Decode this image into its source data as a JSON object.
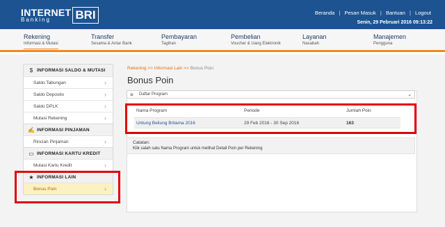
{
  "header": {
    "logo_main": "INTERNET",
    "logo_sub": "Banking",
    "logo_bri": "BRI",
    "links": [
      "Beranda",
      "Pesan Masuk",
      "Bantuan",
      "Logout"
    ],
    "separator": "|",
    "datetime": "Senin, 29 Pebruari 2016 09:13:22"
  },
  "nav": [
    {
      "title": "Rekening",
      "subtitle": "Informasi & Mutasi"
    },
    {
      "title": "Transfer",
      "subtitle": "Sesama & Antar Bank"
    },
    {
      "title": "Pembayaran",
      "subtitle": "Tagihan"
    },
    {
      "title": "Pembelian",
      "subtitle": "Voucher & Uang Elektronik"
    },
    {
      "title": "Layanan",
      "subtitle": "Nasabah"
    },
    {
      "title": "Manajemen",
      "subtitle": "Pengguna"
    }
  ],
  "sidebar": {
    "sections": [
      {
        "icon": "money-icon",
        "glyph": "$",
        "label": "INFORMASI SALDO & MUTASI",
        "items": [
          "Saldo Tabungan",
          "Saldo Deposito",
          "Saldo DPLK",
          "Mutasi Rekening"
        ]
      },
      {
        "icon": "loan-icon",
        "glyph": "✍",
        "label": "INFORMASI PINJAMAN",
        "items": [
          "Rincian Pinjaman"
        ]
      },
      {
        "icon": "card-icon",
        "glyph": "▭",
        "label": "INFORMASI KARTU KREDIT",
        "items": [
          "Mutasi Kartu Kredit"
        ]
      },
      {
        "icon": "star-icon",
        "glyph": "★",
        "label": "INFORMASI LAIN",
        "items": [
          "Bonus Poin"
        ]
      }
    ],
    "chevron": "›"
  },
  "main": {
    "breadcrumb_path": "Rekening >> Informasi Lain >> ",
    "breadcrumb_current": "Bonus Poin",
    "title": "Bonus Poin",
    "dropdown": {
      "label": "Daftar Program",
      "icon": "menu-icon",
      "arrow": "⌄"
    },
    "table": {
      "headers": [
        "Nama Program",
        "Periode",
        "Jumlah Poin"
      ],
      "rows": [
        [
          "Untung Beliung Britama 2016",
          "29 Feb 2016 - 30 Sep 2016",
          "163"
        ]
      ]
    },
    "note": {
      "title": "Catatan:",
      "text": "Klik salah satu Nama Program untuk melihat Detail Poin per Rekening"
    }
  },
  "colors": {
    "header": "#1d5390",
    "accent": "#f28a1e",
    "highlight": "#e10000"
  }
}
